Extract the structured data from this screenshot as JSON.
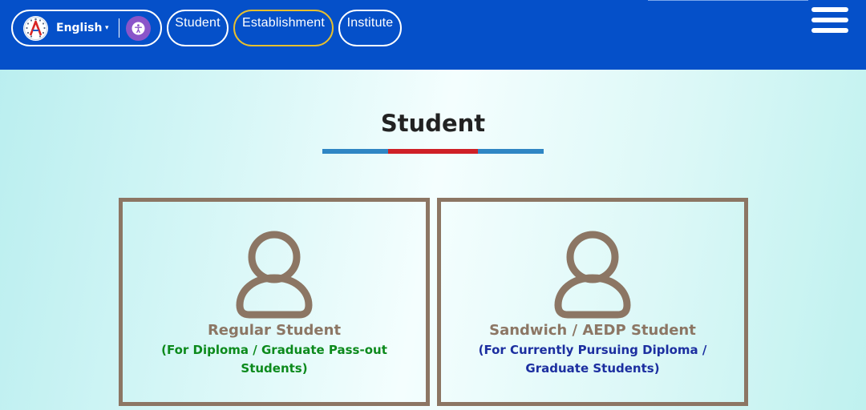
{
  "header": {
    "language": {
      "label": "English",
      "caret": "▾"
    },
    "nav": [
      {
        "label": "Student"
      },
      {
        "label": "Establishment"
      },
      {
        "label": "Institute"
      }
    ],
    "colors": {
      "background": "#0550c9",
      "active_border": "#e7bf2e"
    }
  },
  "section": {
    "title": "Student",
    "underline_colors": [
      "#2f86c4",
      "#cf2027"
    ]
  },
  "cards": [
    {
      "title": "Regular Student",
      "subtitle_lines": [
        "(For Diploma / Graduate Pass-out",
        "Students)"
      ],
      "subtitle_color": "#0c8a1c",
      "icon": "user-icon"
    },
    {
      "title": "Sandwich / AEDP Student",
      "subtitle_lines": [
        "(For Currently Pursuing Diploma /",
        "Graduate Students)"
      ],
      "subtitle_color": "#1c2fa0",
      "icon": "user-icon"
    }
  ],
  "icons": {
    "logo": "logo-icon",
    "accessibility": "accessibility-icon",
    "menu": "hamburger-menu-icon"
  }
}
